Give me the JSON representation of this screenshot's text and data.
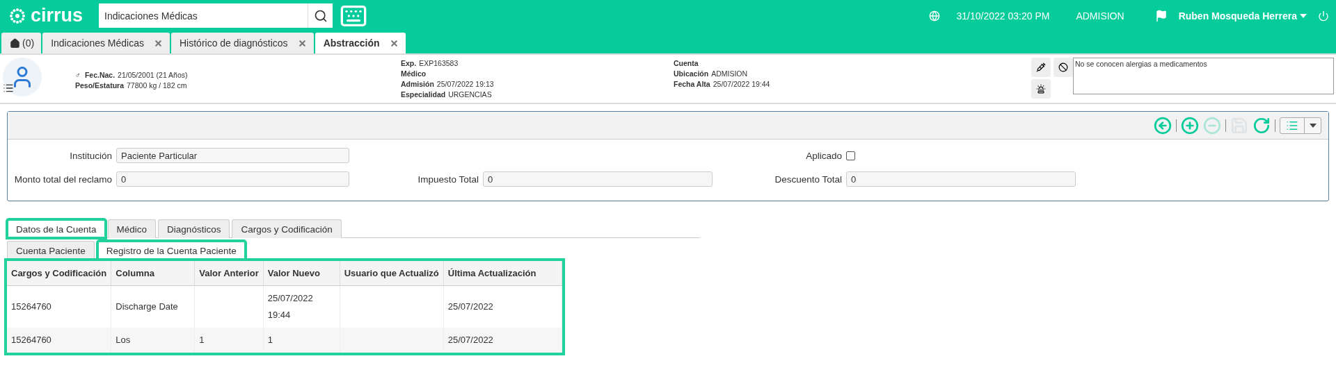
{
  "header": {
    "logo": "cirrus",
    "search": {
      "value": "Indicaciones Médicas"
    },
    "datetime": "31/10/2022 03:20 PM",
    "location": "ADMISION",
    "user": "Ruben Mosqueda Herrera"
  },
  "page_tabs": [
    {
      "kind": "home",
      "label": "(0)",
      "selected": false
    },
    {
      "kind": "closable",
      "label": "Indicaciones Médicas",
      "selected": false
    },
    {
      "kind": "closable",
      "label": "Histórico de diagnósticos",
      "selected": false
    },
    {
      "kind": "closable",
      "label": "Abstracción",
      "selected": true
    }
  ],
  "patient": {
    "sex": "♂",
    "left": [
      {
        "label": "Fec.Nac.",
        "value": "21/05/2001 (21 Años)"
      },
      {
        "label": "Peso/Estatura",
        "value": "77800 kg / 182 cm"
      }
    ],
    "middle": [
      {
        "label": "Exp.",
        "value": "EXP163583"
      },
      {
        "label": "Médico"
      },
      {
        "label": "Admisión",
        "value": "25/07/2022 19:13"
      },
      {
        "label": "Especialidad",
        "value": "URGENCIAS"
      }
    ],
    "right": [
      {
        "label": "Cuenta"
      },
      {
        "label": "Ubicación",
        "value": "ADMISION"
      },
      {
        "label": "Fecha Alta",
        "value": "25/07/2022 19:44"
      }
    ],
    "allergies": "No se conocen alergias a medicamentos"
  },
  "toolbar": [
    {
      "kind": "back",
      "disabled": false
    },
    {
      "kind": "add",
      "disabled": false
    },
    {
      "kind": "remove",
      "disabled": true
    },
    {
      "kind": "save",
      "disabled": true
    },
    {
      "kind": "refresh",
      "disabled": false
    }
  ],
  "form": {
    "institucion": {
      "label": "Institución",
      "value": "Paciente Particular"
    },
    "aplicado": {
      "label": "Aplicado",
      "checked": false
    },
    "monto": {
      "label": "Monto total del reclamo",
      "value": "0"
    },
    "impuesto": {
      "label": "Impuesto Total",
      "value": "0"
    },
    "descuento": {
      "label": "Descuento Total",
      "value": "0"
    }
  },
  "tabs": [
    {
      "label": "Datos de la Cuenta",
      "selected": true,
      "highlighted": true
    },
    {
      "label": "Médico",
      "selected": false,
      "highlighted": false
    },
    {
      "label": "Diagnósticos",
      "selected": false,
      "highlighted": false
    },
    {
      "label": "Cargos y Codificación",
      "selected": false,
      "highlighted": false
    }
  ],
  "subtabs": [
    {
      "label": "Cuenta Paciente",
      "selected": false,
      "highlighted": false
    },
    {
      "label": "Registro de la Cuenta Paciente",
      "selected": true,
      "highlighted": true
    }
  ],
  "table": {
    "highlighted": true,
    "columns": [
      "Cargos y Codificación",
      "Columna",
      "Valor Anterior",
      "Valor Nuevo",
      "Usuario que Actualizó",
      "Última Actualización"
    ],
    "rows": [
      [
        "15264760",
        "Discharge Date",
        "",
        "25/07/2022 19:44",
        "",
        "25/07/2022"
      ],
      [
        "15264760",
        "Los",
        "1",
        "1",
        "",
        "25/07/2022"
      ]
    ]
  }
}
